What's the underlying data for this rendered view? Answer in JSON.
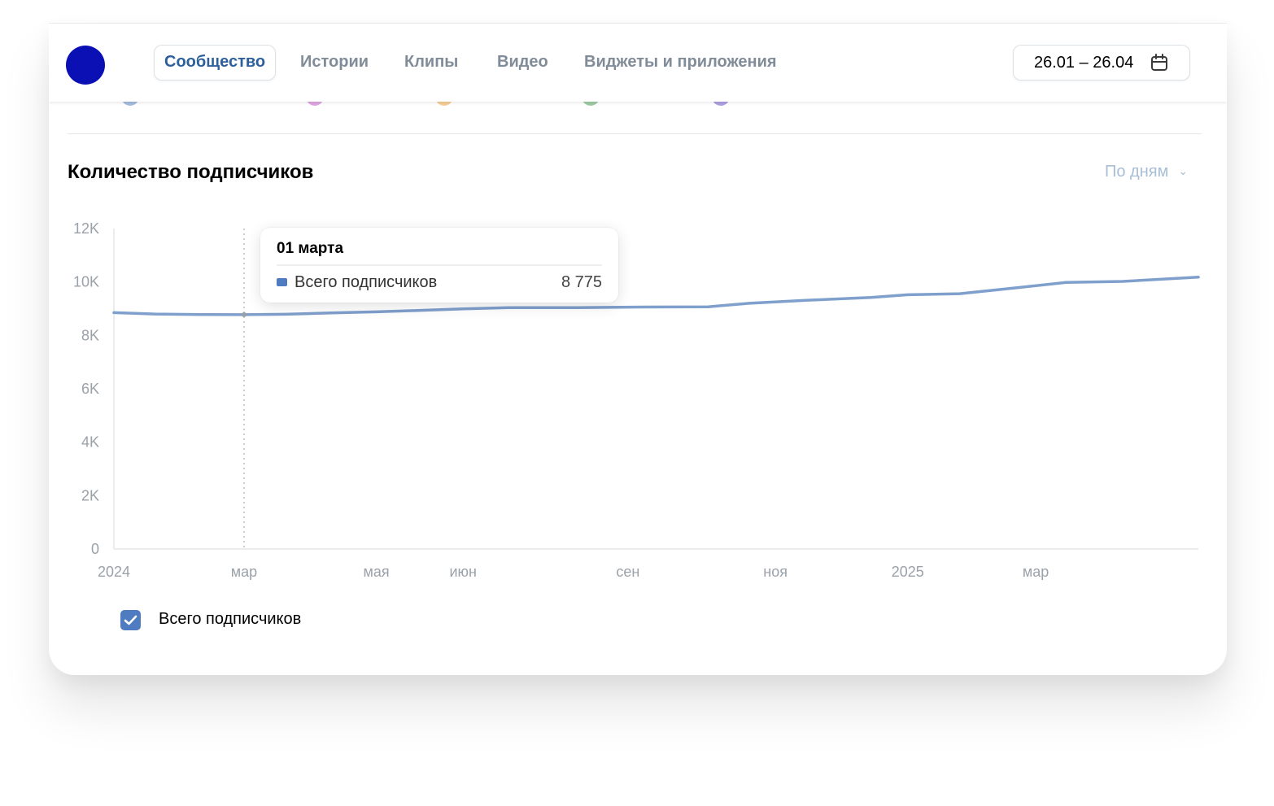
{
  "header": {
    "tabs": [
      {
        "label": "Сообщество",
        "active": true
      },
      {
        "label": "Истории",
        "active": false
      },
      {
        "label": "Клипы",
        "active": false
      },
      {
        "label": "Видео",
        "active": false
      },
      {
        "label": "Виджеты и приложения",
        "active": false
      }
    ],
    "date_range": "26.01 – 26.04",
    "avatar_color": "#0a10b3"
  },
  "section": {
    "title": "Количество подписчиков",
    "period_selector": "По дням"
  },
  "tooltip": {
    "date": "01 марта",
    "series_name": "Всего подписчиков",
    "value": "8 775"
  },
  "legend": {
    "label": "Всего подписчиков",
    "checked": true
  },
  "colors": {
    "series": "#7f9fcc",
    "accent": "#4f7cc0",
    "active_tab": "#2d5f9c",
    "inactive_tab": "#818c99",
    "period": "#a8bed6"
  },
  "chart_data": {
    "type": "line",
    "title": "Количество подписчиков",
    "y_ticks": [
      "0",
      "2K",
      "4K",
      "6K",
      "8K",
      "10K",
      "12K"
    ],
    "ylim": [
      0,
      12000
    ],
    "x_ticks": [
      "2024",
      "мар",
      "мая",
      "июн",
      "сен",
      "ноя",
      "2025",
      "мар"
    ],
    "series": [
      {
        "name": "Всего подписчиков",
        "points": [
          {
            "x": "2024-01-01",
            "y": 8850
          },
          {
            "x": "2024-01-20",
            "y": 8800
          },
          {
            "x": "2024-02-10",
            "y": 8780
          },
          {
            "x": "2024-03-01",
            "y": 8775
          },
          {
            "x": "2024-03-20",
            "y": 8790
          },
          {
            "x": "2024-04-10",
            "y": 8840
          },
          {
            "x": "2024-05-01",
            "y": 8880
          },
          {
            "x": "2024-05-20",
            "y": 8930
          },
          {
            "x": "2024-06-10",
            "y": 8990
          },
          {
            "x": "2024-07-01",
            "y": 9040
          },
          {
            "x": "2024-08-01",
            "y": 9040
          },
          {
            "x": "2024-09-01",
            "y": 9060
          },
          {
            "x": "2024-10-01",
            "y": 9070
          },
          {
            "x": "2024-10-20",
            "y": 9200
          },
          {
            "x": "2024-11-15",
            "y": 9310
          },
          {
            "x": "2024-12-15",
            "y": 9420
          },
          {
            "x": "2025-01-01",
            "y": 9520
          },
          {
            "x": "2025-01-25",
            "y": 9560
          },
          {
            "x": "2025-02-20",
            "y": 9780
          },
          {
            "x": "2025-03-15",
            "y": 9980
          },
          {
            "x": "2025-04-10",
            "y": 10020
          },
          {
            "x": "2025-05-15",
            "y": 10180
          }
        ]
      }
    ],
    "highlight": {
      "x": "2024-03-01",
      "y": 8775
    }
  }
}
